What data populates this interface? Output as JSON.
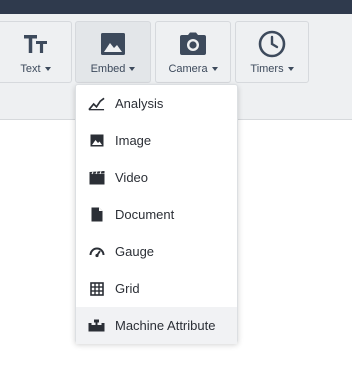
{
  "toolbar": {
    "text_label": "Text",
    "embed_label": "Embed",
    "camera_label": "Camera",
    "timers_label": "Timers"
  },
  "embed_menu": {
    "items": [
      {
        "label": "Analysis",
        "icon": "analysis-icon"
      },
      {
        "label": "Image",
        "icon": "image-icon"
      },
      {
        "label": "Video",
        "icon": "video-icon"
      },
      {
        "label": "Document",
        "icon": "document-icon"
      },
      {
        "label": "Gauge",
        "icon": "gauge-icon"
      },
      {
        "label": "Grid",
        "icon": "grid-icon"
      },
      {
        "label": "Machine Attribute",
        "icon": "machine-attribute-icon"
      }
    ],
    "hovered_item": "Machine Attribute"
  },
  "colors": {
    "topbar": "#2f3a4d",
    "toolbar_bg": "#eef0f2",
    "icon": "#3d4a5c"
  }
}
